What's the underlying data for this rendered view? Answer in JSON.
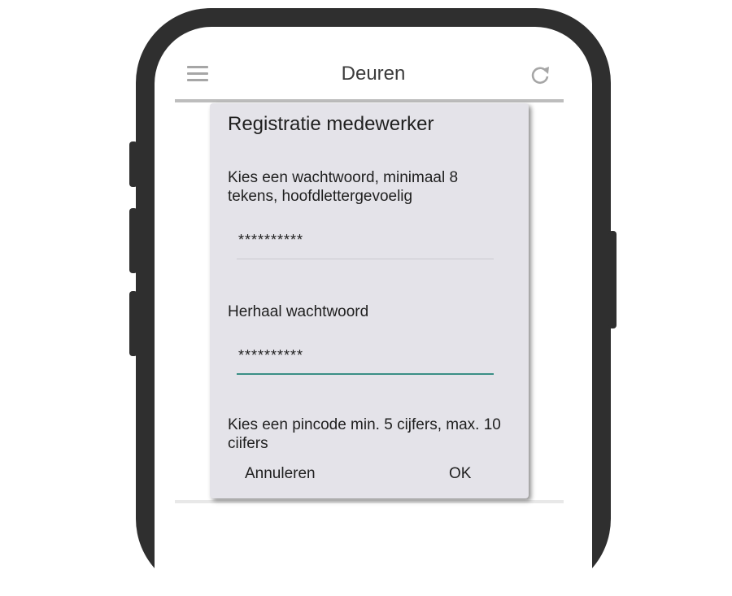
{
  "app_bar": {
    "title": "Deuren",
    "menu_icon": "hamburger-menu-icon",
    "refresh_icon": "refresh-icon"
  },
  "dialog": {
    "title": "Registratie medewerker",
    "password_label": "Kies een wachtwoord, minimaal 8 tekens, hoofdlettergevoelig",
    "password_value": "**********",
    "repeat_label": "Herhaal wachtwoord",
    "repeat_value": "**********",
    "pin_label": "Kies een pincode min. 5 cijfers, max. 10 ciifers",
    "cancel_label": "Annuleren",
    "ok_label": "OK"
  },
  "colors": {
    "dialog_background": "#e4e3e9",
    "focus_accent": "#3a8f86",
    "phone_frame": "#2f2f2f"
  }
}
